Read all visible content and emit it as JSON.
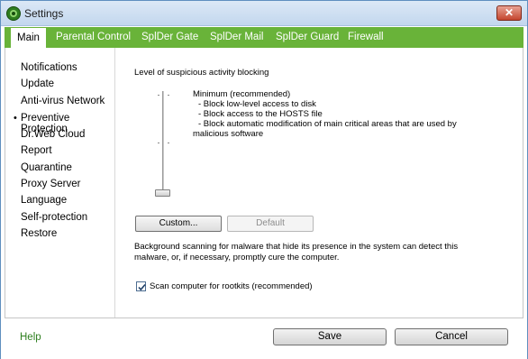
{
  "window": {
    "title": "Settings"
  },
  "tabs": [
    "Main",
    "Parental Control",
    "SplDer Gate",
    "SplDer Mail",
    "SplDer Guard",
    "Firewall"
  ],
  "sidebar": {
    "items": [
      "Notifications",
      "Update",
      "Anti-virus Network",
      "Preventive Protection",
      "Dr.Web Cloud",
      "Report",
      "Quarantine",
      "Proxy Server",
      "Language",
      "Self-protection",
      "Restore"
    ],
    "active_bullet": "•"
  },
  "main": {
    "section_title": "Level of suspicious activity blocking",
    "level_name": "Minimum (recommended)",
    "level_details": [
      "- Block low-level access to disk",
      "- Block access to the HOSTS file",
      "- Block automatic modification of main critical areas that are used by"
    ],
    "level_details_cont": "malicious software",
    "custom_button": "Custom...",
    "default_button": "Default",
    "scan_description_line1": "Background scanning for malware that hide its presence in the system can detect this",
    "scan_description_line2": "malware, or, if necessary, promptly cure the computer.",
    "rootkit_checkbox_label": "Scan computer for rootkits (recommended)",
    "rootkit_checked": true
  },
  "footer": {
    "help": "Help",
    "save": "Save",
    "cancel": "Cancel"
  },
  "colors": {
    "tabbar": "#69b339",
    "help_link": "#2f7f1f"
  }
}
